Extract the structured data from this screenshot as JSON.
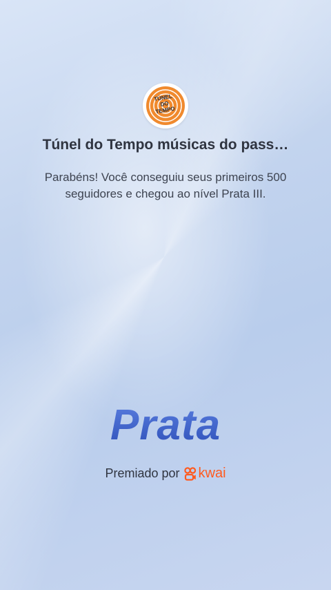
{
  "profile": {
    "avatar_icon": "tunel-do-tempo-logo-icon",
    "avatar_logo_text": [
      "TÚNEL",
      "DO",
      "TEMPO"
    ],
    "name": "Túnel do Tempo músicas do pass…"
  },
  "achievement": {
    "message": "Parabéns! Você conseguiu seus primeiros 500 seguidores e chegou ao nível Prata III.",
    "level_name": "Prata",
    "level_color": "#3b5fc9"
  },
  "footer": {
    "awarded_by_label": "Premiado por",
    "brand_icon": "kwai-logo-icon",
    "brand_name": "kwai",
    "brand_color": "#ff5a1f"
  }
}
